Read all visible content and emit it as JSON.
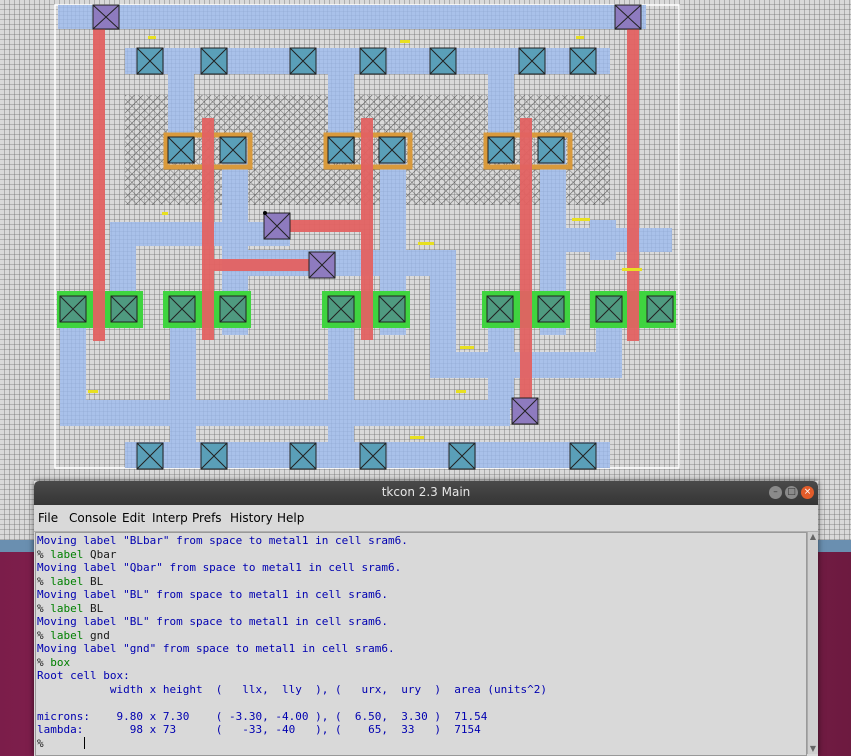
{
  "window": {
    "title": "tkcon 2.3 Main",
    "controls": {
      "minimize": "–",
      "maximize": "□",
      "close": "×"
    }
  },
  "menu": [
    {
      "label": "File"
    },
    {
      "label": "Console"
    },
    {
      "label": "Edit"
    },
    {
      "label": "Interp"
    },
    {
      "label": "Prefs"
    },
    {
      "label": "History"
    },
    {
      "label": "Help"
    }
  ],
  "console": {
    "prompt": "% ",
    "lines": [
      {
        "kind": "out",
        "text": "Moving label \"BLbar\" from space to metal1 in cell sram6."
      },
      {
        "kind": "cmd",
        "prompt": "% ",
        "cmd": "label",
        "arg": " Qbar"
      },
      {
        "kind": "out",
        "text": "Moving label \"Qbar\" from space to metal1 in cell sram6."
      },
      {
        "kind": "cmd",
        "prompt": "% ",
        "cmd": "label",
        "arg": " BL"
      },
      {
        "kind": "out",
        "text": "Moving label \"BL\" from space to metal1 in cell sram6."
      },
      {
        "kind": "cmd",
        "prompt": "% ",
        "cmd": "label",
        "arg": " BL"
      },
      {
        "kind": "out",
        "text": "Moving label \"BL\" from space to metal1 in cell sram6."
      },
      {
        "kind": "cmd",
        "prompt": "% ",
        "cmd": "label",
        "arg": " gnd"
      },
      {
        "kind": "out",
        "text": "Moving label \"gnd\" from space to metal1 in cell sram6."
      },
      {
        "kind": "cmd",
        "prompt": "% ",
        "cmd": "box",
        "arg": ""
      },
      {
        "kind": "out",
        "text": "Root cell box:"
      },
      {
        "kind": "out",
        "text": "           width x height  (   llx,  lly  ), (   urx,  ury  )  area (units^2)"
      },
      {
        "kind": "out",
        "text": ""
      },
      {
        "kind": "out",
        "text": "microns:    9.80 x 7.30    ( -3.30, -4.00 ), (  6.50,  3.30 )  71.54"
      },
      {
        "kind": "out",
        "text": "lambda:       98 x 73      (   -33, -40   ), (    65,  33   )  7154"
      },
      {
        "kind": "cmd",
        "prompt": "% ",
        "cmd": "",
        "arg": ""
      }
    ]
  },
  "layout_colors": {
    "background": "#d8d8d8",
    "grid": "#707070",
    "metal1": "#a8c0e8",
    "poly": "#e06060",
    "diffusion": "#3dd23d",
    "contact": "#5fa0b8",
    "via": "#9a7fc0",
    "well_hatch": "#555555",
    "select": "#e0a040",
    "label": "#e8e020",
    "cellbox": "#ffffff"
  }
}
